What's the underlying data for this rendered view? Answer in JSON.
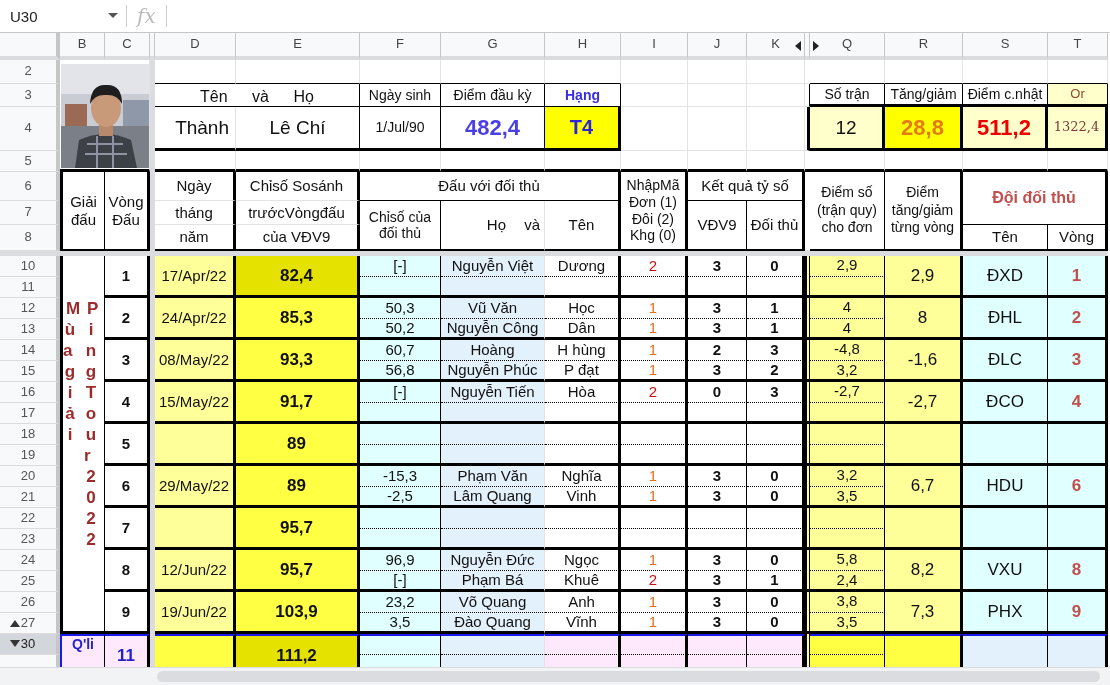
{
  "name_box": {
    "value": "U30"
  },
  "formula_label": "fx",
  "column_headers": [
    "B",
    "C",
    "D",
    "E",
    "F",
    "G",
    "H",
    "I",
    "J",
    "K",
    "Q",
    "R",
    "S",
    "T"
  ],
  "row_numbers": [
    {
      "label": "2",
      "selected": false
    },
    {
      "label": "3",
      "selected": false
    },
    {
      "label": "4",
      "selected": false
    },
    {
      "label": "5",
      "selected": false
    },
    {
      "label": "6",
      "selected": false
    },
    {
      "label": "7",
      "selected": false
    },
    {
      "label": "8",
      "selected": false
    },
    {
      "label": "10",
      "selected": false
    },
    {
      "label": "11",
      "selected": false
    },
    {
      "label": "12",
      "selected": false
    },
    {
      "label": "13",
      "selected": false
    },
    {
      "label": "14",
      "selected": false
    },
    {
      "label": "15",
      "selected": false
    },
    {
      "label": "16",
      "selected": false
    },
    {
      "label": "17",
      "selected": false
    },
    {
      "label": "18",
      "selected": false
    },
    {
      "label": "19",
      "selected": false
    },
    {
      "label": "20",
      "selected": false
    },
    {
      "label": "21",
      "selected": false
    },
    {
      "label": "22",
      "selected": false
    },
    {
      "label": "23",
      "selected": false
    },
    {
      "label": "24",
      "selected": false
    },
    {
      "label": "25",
      "selected": false
    },
    {
      "label": "26",
      "selected": false
    },
    {
      "label": "27",
      "selected": false,
      "kind": "group_end"
    },
    {
      "label": "30",
      "selected": true,
      "kind": "group_start"
    }
  ],
  "profile": {
    "name_header": "Tên và Họ",
    "birth_header": "Ngày sinh",
    "start_header": "Điểm đầu kỳ",
    "rank_header": "Hạng",
    "given_name": "Thành",
    "family_name": "Lê Chí",
    "birth_date": "1/Jul/90",
    "start_points": "482,4",
    "rank": "T4"
  },
  "summary": {
    "matches_header": "Số trận",
    "change_header": "Tăng/giảm",
    "points_header": "Điểm c.nhật",
    "column_4_header": "Or",
    "matches": "12",
    "change": "28,8",
    "points": "511,2",
    "column_4": "1322,4"
  },
  "table_headers": {
    "event": "Giải đấu",
    "round": "Vòng Đấu",
    "date": [
      "Ngày",
      "tháng",
      "năm"
    ],
    "index": [
      "Chỉsố Sosánh",
      "trướcVòngđấu",
      "của VĐV9"
    ],
    "versus": "Đấu với đối thủ",
    "opp_index": "Chỉsố của đối thủ",
    "opp_family": "Họ và",
    "opp_given": "Tên",
    "code": "NhậpMã Đơn (1) Đôi (2) Khg (0)",
    "result": "Kết quả tỷ số",
    "result_self": "VĐV9",
    "result_opp": "Đối thủ",
    "score": "Điểm số (trận quy) cho đơn",
    "delta": "Điểm tăng/giảm từng vòng",
    "team": "Đội đối thủ",
    "team_name": "Tên",
    "team_round": "Vòng"
  },
  "tournament": {
    "line_1": "Mùa giải",
    "line_2": "PingTour 2022"
  },
  "rounds": [
    {
      "round": "1",
      "date": "17/Apr/22",
      "index": "82,4",
      "highlighted": true,
      "matches": [
        {
          "opp_index": "[-]",
          "family": "Nguyễn Việt",
          "given": "Dương",
          "code": "2",
          "kind": "doubles",
          "self": "3",
          "opp": "0",
          "score": "2,9"
        }
      ],
      "delta": "2,9",
      "team": "ĐXD",
      "team_round": "1"
    },
    {
      "round": "2",
      "date": "24/Apr/22",
      "index": "85,3",
      "highlighted": false,
      "matches": [
        {
          "opp_index": "50,3",
          "family": "Vũ Văn",
          "given": "Học",
          "code": "1",
          "kind": "singles",
          "self": "3",
          "opp": "1",
          "score": "4"
        },
        {
          "opp_index": "50,2",
          "family": "Nguyễn Công",
          "given": "Dân",
          "code": "1",
          "kind": "singles",
          "self": "3",
          "opp": "1",
          "score": "4"
        }
      ],
      "delta": "8",
      "team": "ĐHL",
      "team_round": "2"
    },
    {
      "round": "3",
      "date": "08/May/22",
      "index": "93,3",
      "highlighted": false,
      "matches": [
        {
          "opp_index": "60,7",
          "family": "Hoàng",
          "given": "H hùng",
          "code": "1",
          "kind": "singles",
          "self": "2",
          "opp": "3",
          "score": "-4,8"
        },
        {
          "opp_index": "56,8",
          "family": "Nguyễn Phúc",
          "given": "P đạt",
          "code": "1",
          "kind": "singles",
          "self": "3",
          "opp": "2",
          "score": "3,2"
        }
      ],
      "delta": "-1,6",
      "team": "ĐLC",
      "team_round": "3"
    },
    {
      "round": "4",
      "date": "15/May/22",
      "index": "91,7",
      "highlighted": false,
      "matches": [
        {
          "opp_index": "[-]",
          "family": "Nguyễn Tiến",
          "given": "Hòa",
          "code": "2",
          "kind": "doubles",
          "self": "0",
          "opp": "3",
          "score": "-2,7"
        }
      ],
      "delta": "-2,7",
      "team": "ĐCO",
      "team_round": "4"
    },
    {
      "round": "5",
      "index": "89",
      "highlighted": false
    },
    {
      "round": "6",
      "date": "29/May/22",
      "index": "89",
      "highlighted": false,
      "matches": [
        {
          "opp_index": "-15,3",
          "family": "Phạm Văn",
          "given": "Nghĩa",
          "code": "1",
          "kind": "singles",
          "self": "3",
          "opp": "0",
          "score": "3,2"
        },
        {
          "opp_index": "-2,5",
          "family": "Lâm Quang",
          "given": "Vinh",
          "code": "1",
          "kind": "singles",
          "self": "3",
          "opp": "0",
          "score": "3,5"
        }
      ],
      "delta": "6,7",
      "team": "HDU",
      "team_round": "6"
    },
    {
      "round": "7",
      "index": "95,7",
      "highlighted": false
    },
    {
      "round": "8",
      "date": "12/Jun/22",
      "index": "95,7",
      "highlighted": false,
      "matches": [
        {
          "opp_index": "96,9",
          "family": "Nguyễn Đức",
          "given": "Ngọc",
          "code": "1",
          "kind": "singles",
          "self": "3",
          "opp": "0",
          "score": "5,8"
        },
        {
          "opp_index": "[-]",
          "family": "Phạm Bá",
          "given": "Khuê",
          "code": "2",
          "kind": "doubles",
          "self": "3",
          "opp": "1",
          "score": "2,4"
        }
      ],
      "delta": "8,2",
      "team": "VXU",
      "team_round": "8"
    },
    {
      "round": "9",
      "date": "19/Jun/22",
      "index": "103,9",
      "highlighted": false,
      "matches": [
        {
          "opp_index": "23,2",
          "family": "Võ Quang",
          "given": "Anh",
          "code": "1",
          "kind": "singles",
          "self": "3",
          "opp": "0",
          "score": "3,8"
        },
        {
          "opp_index": "3,5",
          "family": "Đào Quang",
          "given": "Vĩnh",
          "code": "1",
          "kind": "singles",
          "self": "3",
          "opp": "0",
          "score": "3,5"
        }
      ],
      "delta": "7,3",
      "team": "PHX",
      "team_round": "9"
    }
  ],
  "qualifier": {
    "label": "Q'li",
    "round": "11",
    "index": "111,2",
    "highlighted": true
  }
}
